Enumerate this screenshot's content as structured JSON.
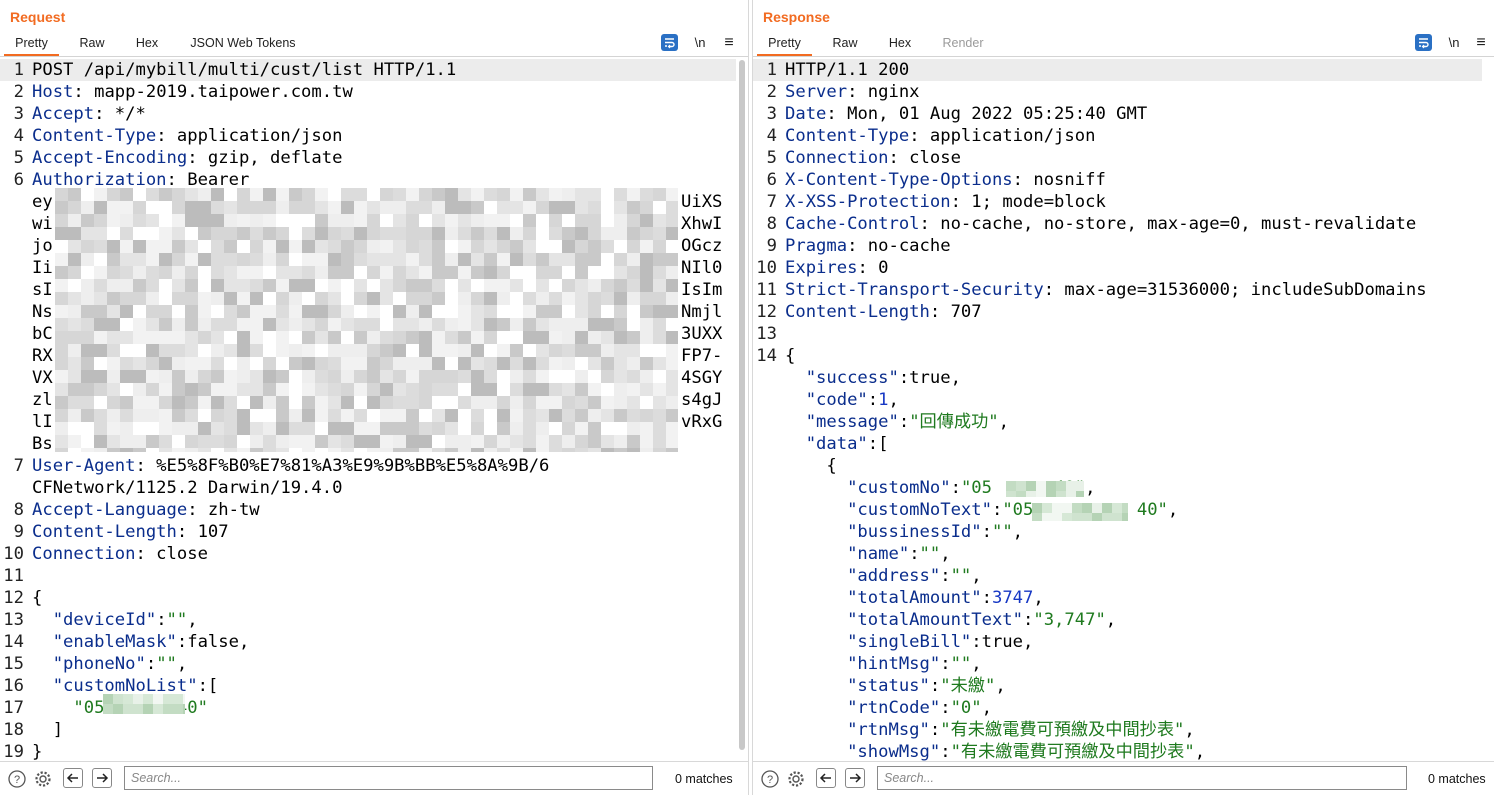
{
  "request": {
    "title": "Request",
    "tabs": [
      {
        "label": "Pretty",
        "active": true
      },
      {
        "label": "Raw"
      },
      {
        "label": "Hex"
      },
      {
        "label": "JSON Web Tokens"
      }
    ],
    "tools": {
      "wrap_icon": "wrap-lines-icon",
      "newline": "\\n",
      "menu": "≡"
    },
    "lines": [
      {
        "n": "1",
        "parts": [
          {
            "t": "POST /api/mybill/multi/cust/list HTTP/1.1"
          }
        ],
        "hl": true
      },
      {
        "n": "2",
        "parts": [
          {
            "t": "Host",
            "c": "hk"
          },
          {
            "t": ": mapp-2019.taipower.com.tw"
          }
        ]
      },
      {
        "n": "3",
        "parts": [
          {
            "t": "Accept",
            "c": "hk"
          },
          {
            "t": ": */*"
          }
        ]
      },
      {
        "n": "4",
        "parts": [
          {
            "t": "Content-Type",
            "c": "hk"
          },
          {
            "t": ": application/json"
          }
        ]
      },
      {
        "n": "5",
        "parts": [
          {
            "t": "Accept-Encoding",
            "c": "hk"
          },
          {
            "t": ": gzip, deflate"
          }
        ]
      },
      {
        "n": "6",
        "parts": [
          {
            "t": "Authorization",
            "c": "hk"
          },
          {
            "t": ": Bearer"
          }
        ]
      },
      {
        "n": "",
        "parts": [
          {
            "t": "ey"
          }
        ],
        "tail": "UiXS"
      },
      {
        "n": "",
        "parts": [
          {
            "t": "wi"
          }
        ],
        "tail": "XhwI"
      },
      {
        "n": "",
        "parts": [
          {
            "t": "jo"
          }
        ],
        "tail": "OGcz"
      },
      {
        "n": "",
        "parts": [
          {
            "t": "Ii"
          }
        ],
        "tail": "NIl0"
      },
      {
        "n": "",
        "parts": [
          {
            "t": "sI"
          }
        ],
        "tail": "IsIm"
      },
      {
        "n": "",
        "parts": [
          {
            "t": "Ns"
          }
        ],
        "tail": "Nmjl"
      },
      {
        "n": "",
        "parts": [
          {
            "t": "bC"
          }
        ],
        "tail": "3UXX"
      },
      {
        "n": "",
        "parts": [
          {
            "t": "RX"
          }
        ],
        "tail": "FP7-"
      },
      {
        "n": "",
        "parts": [
          {
            "t": "VX"
          }
        ],
        "tail": "4SGY"
      },
      {
        "n": "",
        "parts": [
          {
            "t": "zl"
          }
        ],
        "tail": "s4gJ"
      },
      {
        "n": "",
        "parts": [
          {
            "t": "lI"
          }
        ],
        "tail": "vRxG"
      },
      {
        "n": "",
        "parts": [
          {
            "t": "Bs"
          }
        ]
      },
      {
        "n": "7",
        "parts": [
          {
            "t": "User-Agent",
            "c": "hk"
          },
          {
            "t": ": %E5%8F%B0%E7%81%A3%E9%9B%BB%E5%8A%9B/6"
          }
        ]
      },
      {
        "n": "",
        "parts": [
          {
            "t": "CFNetwork/1125.2 Darwin/19.4.0"
          }
        ]
      },
      {
        "n": "8",
        "parts": [
          {
            "t": "Accept-Language",
            "c": "hk"
          },
          {
            "t": ": zh-tw"
          }
        ]
      },
      {
        "n": "9",
        "parts": [
          {
            "t": "Content-Length",
            "c": "hk"
          },
          {
            "t": ": 107"
          }
        ]
      },
      {
        "n": "10",
        "parts": [
          {
            "t": "Connection",
            "c": "hk"
          },
          {
            "t": ": close"
          }
        ]
      },
      {
        "n": "11",
        "parts": []
      },
      {
        "n": "12",
        "parts": [
          {
            "t": "{"
          }
        ]
      },
      {
        "n": "13",
        "parts": [
          {
            "t": "  \"deviceId\"",
            "c": "hk"
          },
          {
            "t": ":"
          },
          {
            "t": "\"\"",
            "c": "str"
          },
          {
            "t": ","
          }
        ]
      },
      {
        "n": "14",
        "parts": [
          {
            "t": "  \"enableMask\"",
            "c": "hk"
          },
          {
            "t": ":false,"
          }
        ]
      },
      {
        "n": "15",
        "parts": [
          {
            "t": "  \"phoneNo\"",
            "c": "hk"
          },
          {
            "t": ":"
          },
          {
            "t": "\"\"",
            "c": "str"
          },
          {
            "t": ","
          }
        ]
      },
      {
        "n": "16",
        "parts": [
          {
            "t": "  \"customNoList\"",
            "c": "hk"
          },
          {
            "t": ":["
          }
        ]
      },
      {
        "n": "17",
        "parts": [
          {
            "t": "    \"05       40\"",
            "c": "str"
          }
        ]
      },
      {
        "n": "18",
        "parts": [
          {
            "t": "  ]"
          }
        ]
      },
      {
        "n": "19",
        "parts": [
          {
            "t": "}"
          }
        ]
      }
    ],
    "search_placeholder": "Search...",
    "matches": "0 matches"
  },
  "response": {
    "title": "Response",
    "tabs": [
      {
        "label": "Pretty",
        "active": true
      },
      {
        "label": "Raw"
      },
      {
        "label": "Hex"
      },
      {
        "label": "Render",
        "disabled": true
      }
    ],
    "tools": {
      "wrap_icon": "wrap-lines-icon",
      "newline": "\\n",
      "menu": "≡"
    },
    "lines": [
      {
        "n": "1",
        "parts": [
          {
            "t": "HTTP/1.1 200"
          }
        ],
        "hl": true
      },
      {
        "n": "2",
        "parts": [
          {
            "t": "Server",
            "c": "hk"
          },
          {
            "t": ": nginx"
          }
        ]
      },
      {
        "n": "3",
        "parts": [
          {
            "t": "Date",
            "c": "hk"
          },
          {
            "t": ": Mon, 01 Aug 2022 05:25:40 GMT"
          }
        ]
      },
      {
        "n": "4",
        "parts": [
          {
            "t": "Content-Type",
            "c": "hk"
          },
          {
            "t": ": application/json"
          }
        ]
      },
      {
        "n": "5",
        "parts": [
          {
            "t": "Connection",
            "c": "hk"
          },
          {
            "t": ": close"
          }
        ]
      },
      {
        "n": "6",
        "parts": [
          {
            "t": "X-Content-Type-Options",
            "c": "hk"
          },
          {
            "t": ": nosniff"
          }
        ]
      },
      {
        "n": "7",
        "parts": [
          {
            "t": "X-XSS-Protection",
            "c": "hk"
          },
          {
            "t": ": 1; mode=block"
          }
        ]
      },
      {
        "n": "8",
        "parts": [
          {
            "t": "Cache-Control",
            "c": "hk"
          },
          {
            "t": ": no-cache, no-store, max-age=0, must-revalidate"
          }
        ]
      },
      {
        "n": "9",
        "parts": [
          {
            "t": "Pragma",
            "c": "hk"
          },
          {
            "t": ": no-cache"
          }
        ]
      },
      {
        "n": "10",
        "parts": [
          {
            "t": "Expires",
            "c": "hk"
          },
          {
            "t": ": 0"
          }
        ]
      },
      {
        "n": "11",
        "parts": [
          {
            "t": "Strict-Transport-Security",
            "c": "hk"
          },
          {
            "t": ": max-age=31536000; includeSubDomains"
          }
        ]
      },
      {
        "n": "12",
        "parts": [
          {
            "t": "Content-Length",
            "c": "hk"
          },
          {
            "t": ": 707"
          }
        ]
      },
      {
        "n": "13",
        "parts": []
      },
      {
        "n": "14",
        "parts": [
          {
            "t": "{"
          }
        ]
      },
      {
        "n": "",
        "parts": [
          {
            "t": "  \"success\"",
            "c": "hk"
          },
          {
            "t": ":true,"
          }
        ]
      },
      {
        "n": "",
        "parts": [
          {
            "t": "  \"code\"",
            "c": "hk"
          },
          {
            "t": ":"
          },
          {
            "t": "1",
            "c": "num"
          },
          {
            "t": ","
          }
        ]
      },
      {
        "n": "",
        "parts": [
          {
            "t": "  \"message\"",
            "c": "hk"
          },
          {
            "t": ":"
          },
          {
            "t": "\"回傳成功\"",
            "c": "str"
          },
          {
            "t": ","
          }
        ]
      },
      {
        "n": "",
        "parts": [
          {
            "t": "  \"data\"",
            "c": "hk"
          },
          {
            "t": ":["
          }
        ]
      },
      {
        "n": "",
        "parts": [
          {
            "t": "    {"
          }
        ]
      },
      {
        "n": "",
        "parts": [
          {
            "t": "      \"customNo\"",
            "c": "hk"
          },
          {
            "t": ":"
          },
          {
            "t": "\"05      40\"",
            "c": "str"
          },
          {
            "t": ","
          }
        ]
      },
      {
        "n": "",
        "parts": [
          {
            "t": "      \"customNoText\"",
            "c": "hk"
          },
          {
            "t": ":"
          },
          {
            "t": "\"05-         40\"",
            "c": "str"
          },
          {
            "t": ","
          }
        ]
      },
      {
        "n": "",
        "parts": [
          {
            "t": "      \"bussinessId\"",
            "c": "hk"
          },
          {
            "t": ":"
          },
          {
            "t": "\"\"",
            "c": "str"
          },
          {
            "t": ","
          }
        ]
      },
      {
        "n": "",
        "parts": [
          {
            "t": "      \"name\"",
            "c": "hk"
          },
          {
            "t": ":"
          },
          {
            "t": "\"\"",
            "c": "str"
          },
          {
            "t": ","
          }
        ]
      },
      {
        "n": "",
        "parts": [
          {
            "t": "      \"address\"",
            "c": "hk"
          },
          {
            "t": ":"
          },
          {
            "t": "\"\"",
            "c": "str"
          },
          {
            "t": ","
          }
        ]
      },
      {
        "n": "",
        "parts": [
          {
            "t": "      \"totalAmount\"",
            "c": "hk"
          },
          {
            "t": ":"
          },
          {
            "t": "3747",
            "c": "num"
          },
          {
            "t": ","
          }
        ]
      },
      {
        "n": "",
        "parts": [
          {
            "t": "      \"totalAmountText\"",
            "c": "hk"
          },
          {
            "t": ":"
          },
          {
            "t": "\"3,747\"",
            "c": "str"
          },
          {
            "t": ","
          }
        ]
      },
      {
        "n": "",
        "parts": [
          {
            "t": "      \"singleBill\"",
            "c": "hk"
          },
          {
            "t": ":true,"
          }
        ]
      },
      {
        "n": "",
        "parts": [
          {
            "t": "      \"hintMsg\"",
            "c": "hk"
          },
          {
            "t": ":"
          },
          {
            "t": "\"\"",
            "c": "str"
          },
          {
            "t": ","
          }
        ]
      },
      {
        "n": "",
        "parts": [
          {
            "t": "      \"status\"",
            "c": "hk"
          },
          {
            "t": ":"
          },
          {
            "t": "\"未繳\"",
            "c": "str"
          },
          {
            "t": ","
          }
        ]
      },
      {
        "n": "",
        "parts": [
          {
            "t": "      \"rtnCode\"",
            "c": "hk"
          },
          {
            "t": ":"
          },
          {
            "t": "\"0\"",
            "c": "str"
          },
          {
            "t": ","
          }
        ]
      },
      {
        "n": "",
        "parts": [
          {
            "t": "      \"rtnMsg\"",
            "c": "hk"
          },
          {
            "t": ":"
          },
          {
            "t": "\"有未繳電費可預繳及中間抄表\"",
            "c": "str"
          },
          {
            "t": ","
          }
        ]
      },
      {
        "n": "",
        "parts": [
          {
            "t": "      \"showMsg\"",
            "c": "hk"
          },
          {
            "t": ":"
          },
          {
            "t": "\"有未繳電費可預繳及中間抄表\"",
            "c": "str"
          },
          {
            "t": ","
          }
        ]
      }
    ],
    "search_placeholder": "Search...",
    "matches": "0 matches"
  },
  "colors": {
    "accent": "#f26b21",
    "header_key": "#0a2d8c",
    "string": "#1f7a1f",
    "number": "#1738c4",
    "button_blue": "#2a70c4"
  },
  "icons": [
    "help-icon",
    "settings-gear-icon",
    "arrow-left-icon",
    "arrow-right-icon",
    "wrap-lines-icon",
    "menu-icon",
    "layout-side-by-side-icon",
    "layout-stacked-icon",
    "layout-single-icon"
  ]
}
